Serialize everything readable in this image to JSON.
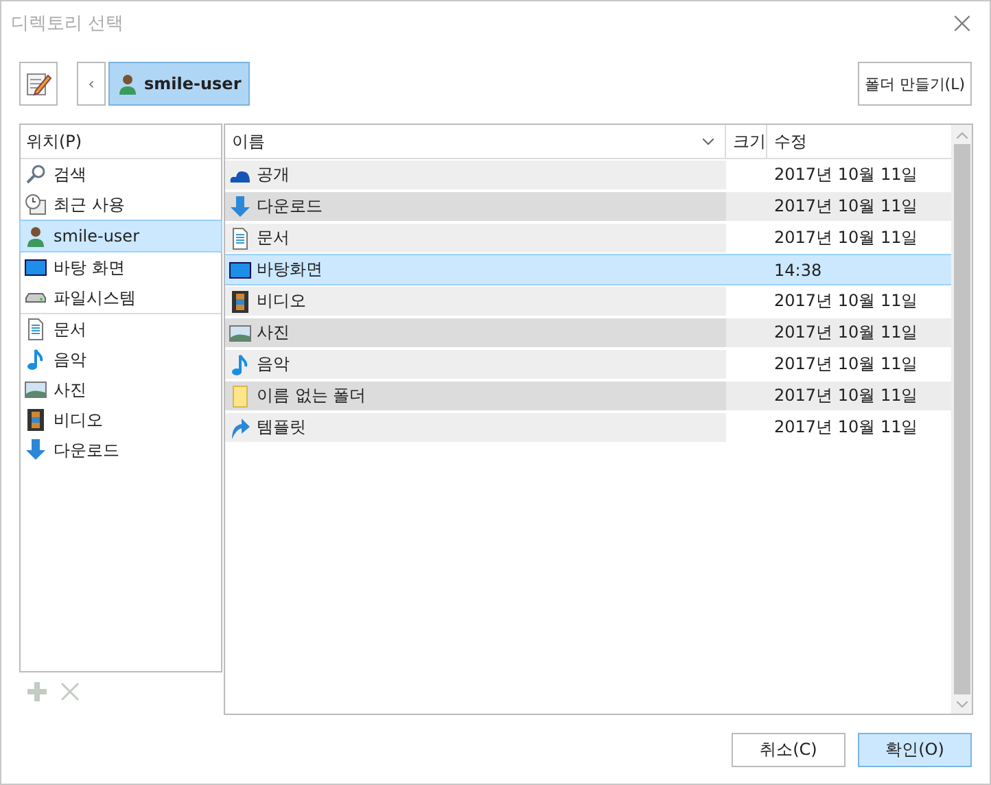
{
  "window": {
    "title": "디렉토리 선택",
    "close": "×"
  },
  "toolbar": {
    "back": "‹",
    "path": [
      {
        "label": "smile-user",
        "kind": "user",
        "selected": true
      }
    ],
    "new_folder": "폴더 만들기(L)"
  },
  "sidebar": {
    "header": "위치(P)",
    "sections": [
      {
        "items": [
          {
            "label": "검색",
            "kind": "search",
            "selected": false
          },
          {
            "label": "최근 사용",
            "kind": "recent",
            "selected": false
          },
          {
            "label": "smile-user",
            "kind": "user",
            "selected": true
          },
          {
            "label": "바탕 화면",
            "kind": "desktop",
            "selected": false
          },
          {
            "label": "파일시스템",
            "kind": "drive",
            "selected": false
          }
        ]
      },
      {
        "items": [
          {
            "label": "문서",
            "kind": "document",
            "selected": false
          },
          {
            "label": "음악",
            "kind": "music",
            "selected": false
          },
          {
            "label": "사진",
            "kind": "picture",
            "selected": false
          },
          {
            "label": "비디오",
            "kind": "video",
            "selected": false
          },
          {
            "label": "다운로드",
            "kind": "download",
            "selected": false
          }
        ]
      }
    ],
    "add_disabled": true,
    "remove_disabled": true
  },
  "files": {
    "columns": [
      "이름",
      "크기",
      "수정"
    ],
    "rows": [
      {
        "name": "공개",
        "kind": "cloud",
        "modified": "2017년 10월 11일",
        "selected": false
      },
      {
        "name": "다운로드",
        "kind": "download",
        "modified": "2017년 10월 11일",
        "selected": false
      },
      {
        "name": "문서",
        "kind": "document",
        "modified": "2017년 10월 11일",
        "selected": false
      },
      {
        "name": "바탕화면",
        "kind": "desktop",
        "modified": "14:38",
        "selected": true
      },
      {
        "name": "비디오",
        "kind": "video",
        "modified": "2017년 10월 11일",
        "selected": false
      },
      {
        "name": "사진",
        "kind": "picture",
        "modified": "2017년 10월 11일",
        "selected": false
      },
      {
        "name": "음악",
        "kind": "music",
        "modified": "2017년 10월 11일",
        "selected": false
      },
      {
        "name": "이름 없는 폴더",
        "kind": "folder",
        "modified": "2017년 10월 11일",
        "selected": false
      },
      {
        "name": "템플릿",
        "kind": "template",
        "modified": "2017년 10월 11일",
        "selected": false
      }
    ]
  },
  "buttons": [
    {
      "label": "취소(C)",
      "default": false
    },
    {
      "label": "확인(O)",
      "default": true
    }
  ]
}
